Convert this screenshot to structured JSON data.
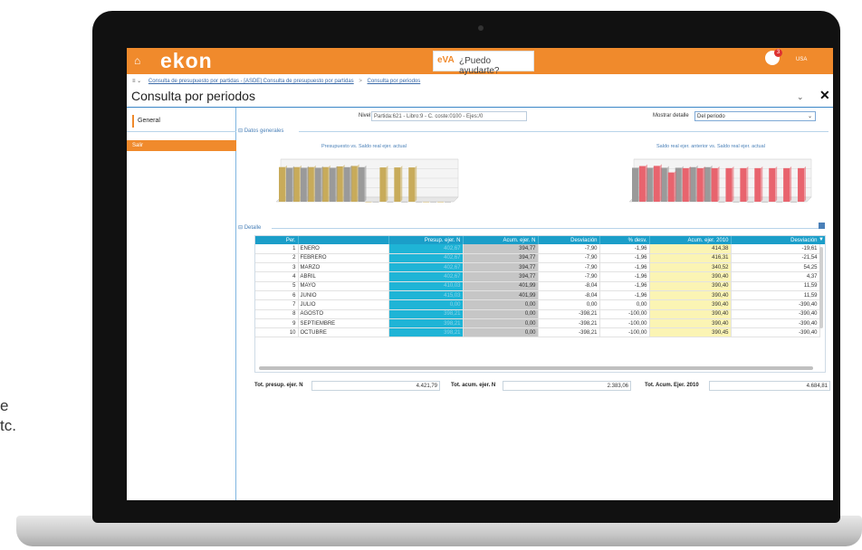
{
  "side_text": {
    "line1": "e",
    "line2": "tc."
  },
  "header": {
    "brand": "ekon",
    "eva_logo": "eVA",
    "eva_prompt": "¿Puedo ayudarte?",
    "user_badge": "3",
    "user_label": "USA"
  },
  "breadcrumb": {
    "menu": "≡ ⌄",
    "items": [
      "Consulta de presupuesto por partidas - [ASDE] Consulta de presupuesto por partidas",
      "Consulta por periodos"
    ],
    "separator": ">"
  },
  "page": {
    "title": "Consulta por periodos"
  },
  "sidebar": {
    "tab_label": "General",
    "exit_label": "Salir"
  },
  "filters": {
    "nivel_label": "Nivel",
    "nivel_value": "Partida:621 - Libro:9 - C. coste:0100 - Ejes:/0",
    "mostrar_label": "Mostrar detalle",
    "mostrar_value": "Del periodo"
  },
  "sections": {
    "datos": "⊟ Datos generales",
    "detalle": "⊟ Detalle"
  },
  "chart_data": [
    {
      "type": "bar",
      "title": "Presupuesto vs. Saldo real ejer. actual",
      "categories": [
        "1",
        "2",
        "3",
        "4",
        "5",
        "6",
        "7",
        "8",
        "9",
        "10",
        "11",
        "12"
      ],
      "series": [
        {
          "values": [
            402,
            402,
            402,
            402,
            410,
            415,
            0,
            398,
            398,
            398,
            0,
            0
          ]
        },
        {
          "values": [
            394,
            394,
            394,
            394,
            401,
            401,
            0,
            0,
            0,
            0,
            0,
            0
          ]
        }
      ],
      "colors": [
        "#c8ab5a",
        "#9a9a9a"
      ]
    },
    {
      "type": "bar",
      "title": "Saldo real ejer. anterior vs. Saldo real ejer. actual",
      "categories": [
        "1",
        "2",
        "3",
        "4",
        "5",
        "6",
        "7",
        "8",
        "9",
        "10",
        "11",
        "12"
      ],
      "series": [
        {
          "values": [
            394,
            394,
            394,
            394,
            401,
            401,
            0,
            0,
            0,
            0,
            0,
            0
          ]
        },
        {
          "values": [
            414,
            416,
            340,
            390,
            390,
            390,
            390,
            390,
            390,
            390,
            390,
            390
          ]
        }
      ],
      "colors": [
        "#9a9a9a",
        "#e8646e"
      ]
    }
  ],
  "grid": {
    "headers": [
      "Per.",
      "",
      "Presup. ejer. N",
      "Acum. ejer. N",
      "Desviación",
      "% desv.",
      "Acum. ejer. 2010",
      "Desviación"
    ],
    "rows": [
      {
        "per": "1",
        "mes": "ENERO",
        "presup": "402,67",
        "acum": "394,77",
        "desv": "-7,90",
        "pct": "-1,96",
        "acum10": "414,38",
        "desv2": "-19,61"
      },
      {
        "per": "2",
        "mes": "FEBRERO",
        "presup": "402,67",
        "acum": "394,77",
        "desv": "-7,90",
        "pct": "-1,96",
        "acum10": "416,31",
        "desv2": "-21,54"
      },
      {
        "per": "3",
        "mes": "MARZO",
        "presup": "402,67",
        "acum": "394,77",
        "desv": "-7,90",
        "pct": "-1,96",
        "acum10": "340,52",
        "desv2": "54,25"
      },
      {
        "per": "4",
        "mes": "ABRIL",
        "presup": "402,67",
        "acum": "394,77",
        "desv": "-7,90",
        "pct": "-1,96",
        "acum10": "390,40",
        "desv2": "4,37"
      },
      {
        "per": "5",
        "mes": "MAYO",
        "presup": "410,03",
        "acum": "401,99",
        "desv": "-8,04",
        "pct": "-1,96",
        "acum10": "390,40",
        "desv2": "11,59"
      },
      {
        "per": "6",
        "mes": "JUNIO",
        "presup": "415,03",
        "acum": "401,99",
        "desv": "-8,04",
        "pct": "-1,96",
        "acum10": "390,40",
        "desv2": "11,59"
      },
      {
        "per": "7",
        "mes": "JULIO",
        "presup": "0,00",
        "acum": "0,00",
        "desv": "0,00",
        "pct": "0,00",
        "acum10": "390,40",
        "desv2": "-390,40"
      },
      {
        "per": "8",
        "mes": "AGOSTO",
        "presup": "398,21",
        "acum": "0,00",
        "desv": "-398,21",
        "pct": "-100,00",
        "acum10": "390,40",
        "desv2": "-390,40"
      },
      {
        "per": "9",
        "mes": "SEPTIEMBRE",
        "presup": "398,21",
        "acum": "0,00",
        "desv": "-398,21",
        "pct": "-100,00",
        "acum10": "390,40",
        "desv2": "-390,40"
      },
      {
        "per": "10",
        "mes": "OCTUBRE",
        "presup": "398,21",
        "acum": "0,00",
        "desv": "-398,21",
        "pct": "-100,00",
        "acum10": "390,45",
        "desv2": "-390,40"
      }
    ]
  },
  "totals": {
    "presup_label": "Tot. presup. ejer. N",
    "presup_value": "4.421,79",
    "acum_label": "Tot. acum. ejer. N",
    "acum_value": "2.383,06",
    "acum10_label": "Tot. Acum. Ejer. 2010",
    "acum10_value": "4.684,81"
  }
}
